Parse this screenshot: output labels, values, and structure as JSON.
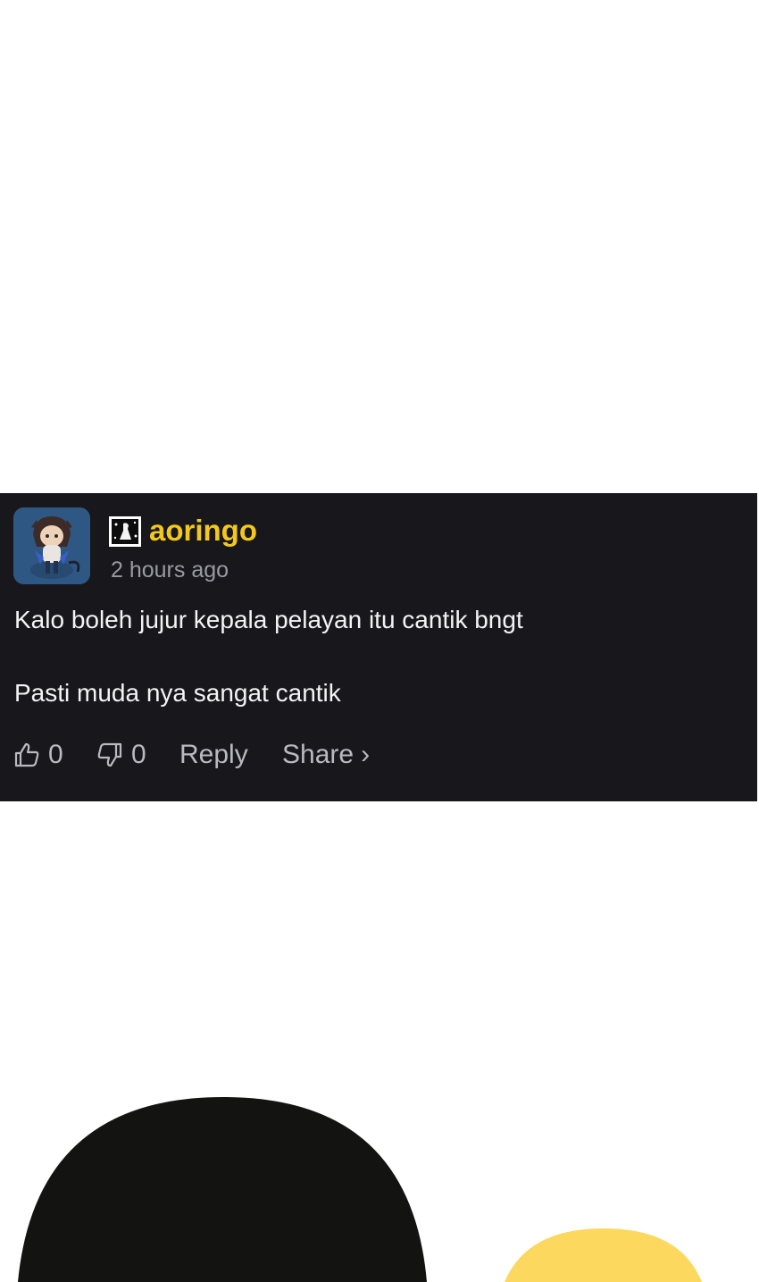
{
  "comment": {
    "username": "aoringo",
    "timestamp": "2 hours ago",
    "body_lines": [
      "Kalo boleh jujur kepala pelayan itu cantik bngt",
      "Pasti muda nya sangat cantik"
    ],
    "likes": "0",
    "dislikes": "0",
    "reply_label": "Reply",
    "share_label": "Share",
    "share_chevron": "›"
  },
  "icons": {
    "avatar": "avatar-image",
    "badge": "user-badge-icon",
    "like": "thumbs-up-icon",
    "dislike": "thumbs-down-icon"
  },
  "colors": {
    "card_background": "#18181c",
    "username": "#f2c81e",
    "body_text": "#f3f3f5",
    "muted_text": "#9a9aa2",
    "action_text": "#b9b9c0",
    "deco_black": "#131312",
    "deco_yellow": "#fcd95e"
  }
}
